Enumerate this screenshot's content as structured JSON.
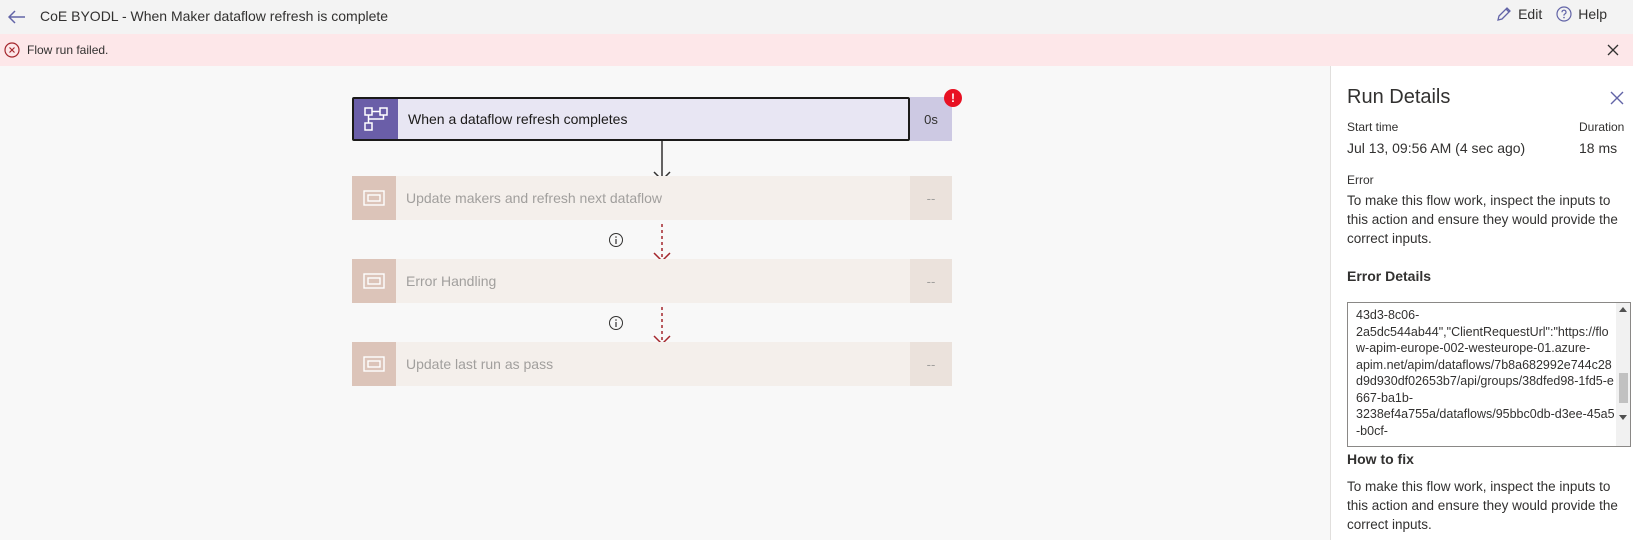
{
  "header": {
    "title": "CoE BYODL - When Maker dataflow refresh is complete",
    "edit_label": "Edit",
    "help_label": "Help"
  },
  "banner": {
    "message": "Flow run failed."
  },
  "flow": {
    "steps": [
      {
        "label": "When a dataflow refresh completes",
        "duration": "0s",
        "status": "failed"
      },
      {
        "label": "Update makers and refresh next dataflow",
        "duration": "--",
        "status": "skipped"
      },
      {
        "label": "Error Handling",
        "duration": "--",
        "status": "skipped"
      },
      {
        "label": "Update last run as pass",
        "duration": "--",
        "status": "skipped"
      }
    ],
    "badge_symbol": "!"
  },
  "run_details": {
    "title": "Run Details",
    "start_time_label": "Start time",
    "start_time_value": "Jul 13, 09:56 AM (4 sec ago)",
    "duration_label": "Duration",
    "duration_value": "18 ms",
    "error_label": "Error",
    "error_text": "To make this flow work, inspect the inputs to this action and ensure they would provide the correct inputs.",
    "error_details_label": "Error Details",
    "error_details_text": "43d3-8c06-\n2a5dc544ab44\",\"ClientRequestUrl\":\"https://flow-apim-europe-002-westeurope-01.azure-\napim.net/apim/dataflows/7b8a682992e744c28d9d930df02653b7/api/groups/38dfed98-1fd5-e667-ba1b-\n3238ef4a755a/dataflows/95bbc0db-d3ee-45a5-b0cf-",
    "how_to_fix_label": "How to fix",
    "how_to_fix_text": "To make this flow work, inspect the inputs to this action and ensure they would provide the correct inputs."
  },
  "colors": {
    "trigger_accent": "#6a5ea8",
    "error_red": "#e81123",
    "banner_bg": "#fde7e9",
    "skipped_connector": "#a4262c",
    "brand_link": "#6264a7"
  }
}
